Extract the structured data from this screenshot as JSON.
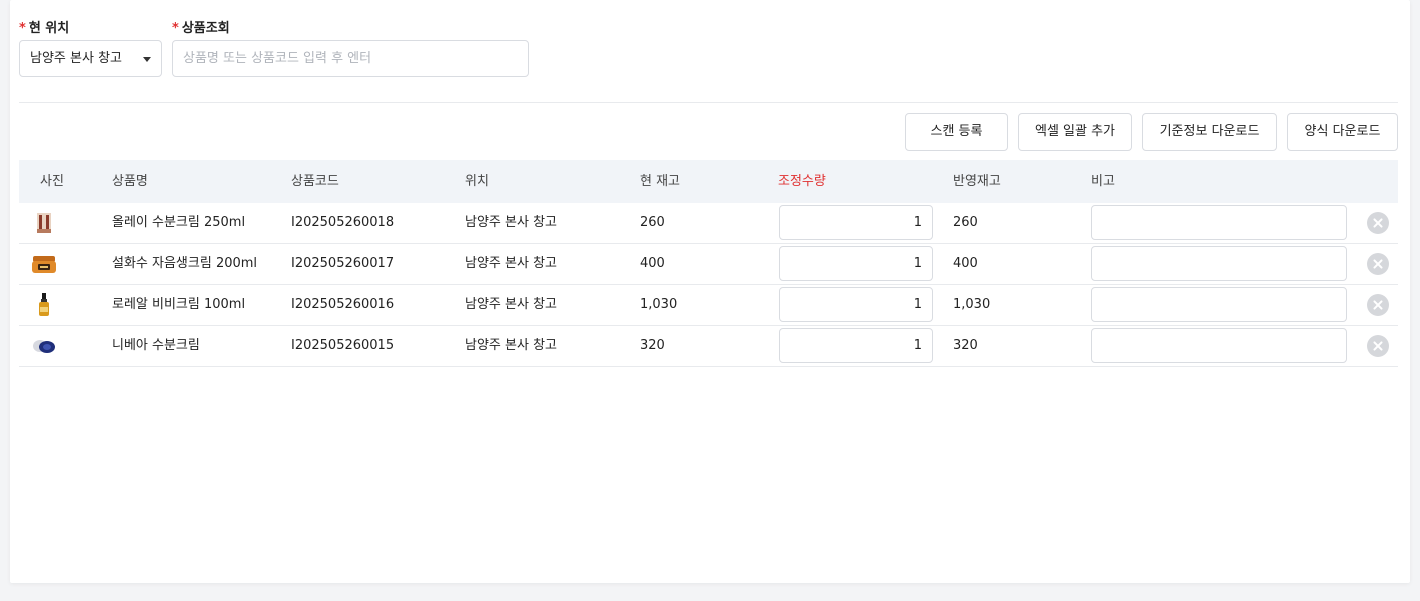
{
  "filters": {
    "location_label": "현 위치",
    "location_value": "남양주 본사 창고",
    "search_label": "상품조회",
    "search_placeholder": "상품명 또는 상품코드 입력 후 엔터",
    "search_value": "",
    "required_mark": "*"
  },
  "toolbar": {
    "scan_label": "스캔 등록",
    "excel_label": "엑셀 일괄 추가",
    "master_download_label": "기준정보 다운로드",
    "template_download_label": "양식 다운로드"
  },
  "table": {
    "headers": {
      "photo": "사진",
      "name": "상품명",
      "code": "상품코드",
      "location": "위치",
      "stock": "현 재고",
      "adjust": "조정수량",
      "reflected": "반영재고",
      "note": "비고"
    },
    "rows": [
      {
        "image": "cream-box-thumbnail",
        "name": "올레이 수분크림 250ml",
        "code": "I202505260018",
        "location": "남양주 본사 창고",
        "stock": "260",
        "adjust": "1",
        "reflected": "260",
        "note": ""
      },
      {
        "image": "gold-jar-thumbnail",
        "name": "설화수 자음생크림 200ml",
        "code": "I202505260017",
        "location": "남양주 본사 창고",
        "stock": "400",
        "adjust": "1",
        "reflected": "400",
        "note": ""
      },
      {
        "image": "serum-bottle-thumbnail",
        "name": "로레알 비비크림 100ml",
        "code": "I202505260016",
        "location": "남양주 본사 창고",
        "stock": "1,030",
        "adjust": "1",
        "reflected": "1,030",
        "note": ""
      },
      {
        "image": "blue-tin-thumbnail",
        "name": "니베아 수분크림",
        "code": "I202505260015",
        "location": "남양주 본사 창고",
        "stock": "320",
        "adjust": "1",
        "reflected": "320",
        "note": ""
      }
    ]
  },
  "colors": {
    "required": "#e03131",
    "header_bg": "#f1f4f8",
    "border": "#d9dce1"
  }
}
